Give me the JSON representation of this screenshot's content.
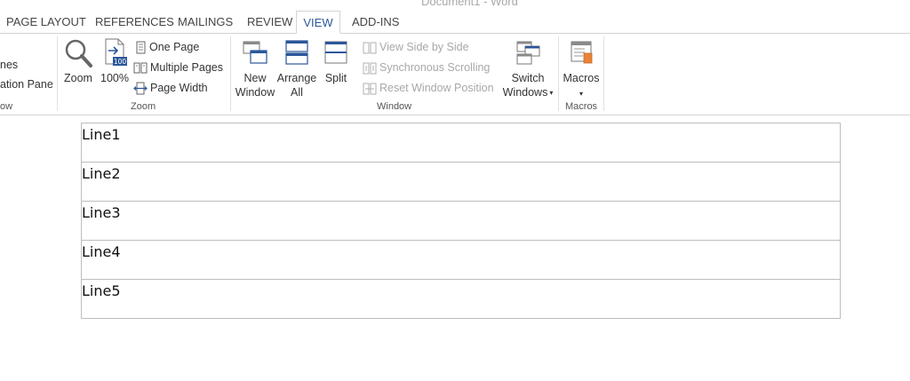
{
  "window": {
    "title": "Document1 - Word"
  },
  "tabs": {
    "page_layout": "PAGE LAYOUT",
    "references": "REFERENCES",
    "mailings": "MAILINGS",
    "review": "REVIEW",
    "view": "VIEW",
    "addins": "ADD-INS",
    "active": "VIEW"
  },
  "ribbon": {
    "show_group": {
      "item_1_partial": "nes",
      "item_2_partial": "ation Pane",
      "label_partial": "ow"
    },
    "zoom_group": {
      "zoom_label": "Zoom",
      "hundred_label": "100%",
      "hundred_icon_text": "100",
      "one_page_label": "One Page",
      "multiple_pages_label": "Multiple Pages",
      "page_width_label": "Page Width",
      "group_label": "Zoom"
    },
    "window_group": {
      "new_window_label_1": "New",
      "new_window_label_2": "Window",
      "arrange_all_label_1": "Arrange",
      "arrange_all_label_2": "All",
      "split_label": "Split",
      "view_side_by_side_label": "View Side by Side",
      "synchronous_scrolling_label": "Synchronous Scrolling",
      "reset_window_position_label": "Reset Window Position",
      "switch_windows_label_1": "Switch",
      "switch_windows_label_2": "Windows",
      "group_label": "Window"
    },
    "macros_group": {
      "macros_label": "Macros",
      "group_label": "Macros"
    }
  },
  "document": {
    "table_rows": [
      "Line1",
      "Line2",
      "Line3",
      "Line4",
      "Line5"
    ]
  },
  "colors": {
    "accent": "#2b579a",
    "disabled_text": "#a8a8a8",
    "table_border": "#bdbdbd"
  }
}
